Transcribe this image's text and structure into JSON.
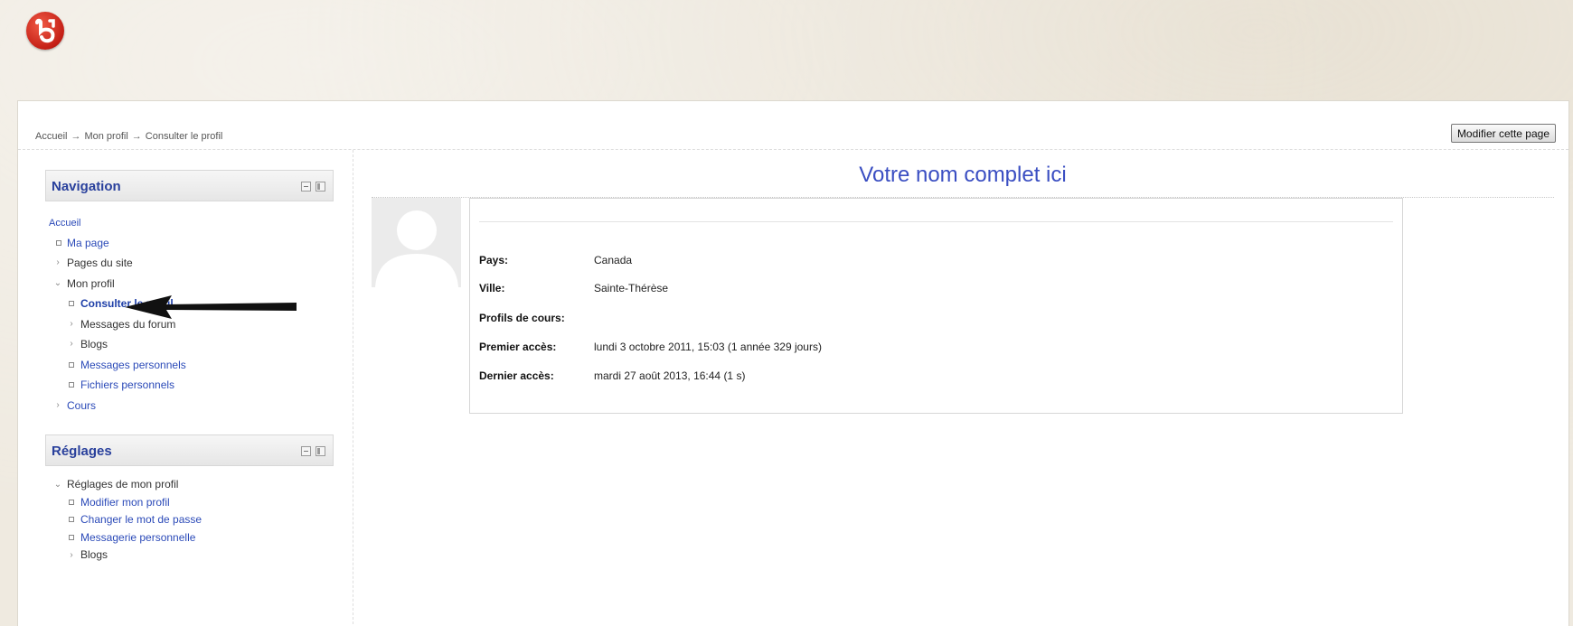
{
  "header": {
    "logo_icon": "moodle-style-logo-icon"
  },
  "breadcrumb": {
    "items": [
      "Accueil",
      "Mon profil",
      "Consulter le profil"
    ],
    "separator": "→"
  },
  "toolbar": {
    "edit_page_label": "Modifier cette page"
  },
  "navigation_block": {
    "title": "Navigation",
    "items": [
      {
        "label": "Accueil",
        "type": "link"
      },
      {
        "label": "Ma page",
        "type": "leaf-link"
      },
      {
        "label": "Pages du site",
        "type": "collapsed"
      },
      {
        "label": "Mon profil",
        "type": "expanded"
      },
      {
        "label": "Consulter le profil",
        "type": "current"
      },
      {
        "label": "Messages du forum",
        "type": "collapsed"
      },
      {
        "label": "Blogs",
        "type": "collapsed"
      },
      {
        "label": "Messages personnels",
        "type": "leaf-link"
      },
      {
        "label": "Fichiers personnels",
        "type": "leaf-link"
      },
      {
        "label": "Cours",
        "type": "collapsed-link"
      }
    ]
  },
  "settings_block": {
    "title": "Réglages",
    "items": [
      {
        "label": "Réglages de mon profil",
        "type": "expanded"
      },
      {
        "label": "Modifier mon profil",
        "type": "leaf-link"
      },
      {
        "label": "Changer le mot de passe",
        "type": "leaf-link"
      },
      {
        "label": "Messagerie personnelle",
        "type": "leaf-link"
      },
      {
        "label": "Blogs",
        "type": "collapsed"
      }
    ]
  },
  "profile": {
    "fullname": "Votre nom complet ici",
    "fields": [
      {
        "label": "Pays:",
        "value": "Canada"
      },
      {
        "label": "Ville:",
        "value": "Sainte-Thérèse"
      },
      {
        "label": "Profils de cours:",
        "value": ""
      },
      {
        "label": "Premier accès:",
        "value": "lundi 3 octobre 2011, 15:03  (1 année 329 jours)"
      },
      {
        "label": "Dernier accès:",
        "value": "mardi 27 août 2013, 16:44  (1 s)"
      }
    ]
  },
  "colors": {
    "link": "#2b4ab8",
    "block_title": "#29409c",
    "fullname": "#3a4ec2",
    "logo_red": "#c41f16"
  }
}
